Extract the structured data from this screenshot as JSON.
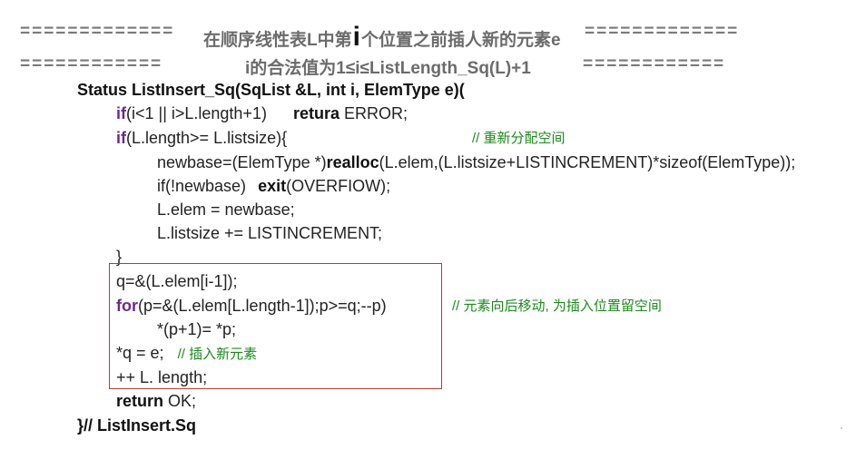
{
  "header": {
    "line1_left": "=============",
    "line1_text_a": "在顺序线性表L中第",
    "line1_big_i": "i",
    "line1_text_b": "个位置之前插人新的元素e",
    "line1_right": "=============",
    "line2_left": "============",
    "line2_text": "i的合法值为1≤i≤ListLength_Sq(L)+1",
    "line2_right": "============"
  },
  "code": {
    "l1": "Status ListInsert_Sq(SqList &L, int i, ElemType e)(",
    "l2_kw": "if",
    "l2_a": "(i<1 || i>L.length+1)",
    "l2_kw2": "retura",
    "l2_b": " ERROR;",
    "l3_kw": "if",
    "l3_a": "(L.length>= L.listsize){",
    "l3_cm": "// 重新分配空间",
    "l4_a": "newbase=(ElemType *)",
    "l4_kw": "realloc",
    "l4_b": "(L.elem,(L.listsize+LISTINCREMENT)*sizeof(ElemType));",
    "l5_a": "if(!newbase)",
    "l5_kw": "exit",
    "l5_b": "(OVERFIOW);",
    "l6": "L.elem = newbase;",
    "l7": "L.listsize += LISTINCREMENT;",
    "l8": "}",
    "l9": "q=&(L.elem[i-1]);",
    "l10_kw": "for",
    "l10_a": "(p=&(L.elem[L.length-1]);p>=q;--p)",
    "l10_cm": "// 元素向后移动, 为插入位置留空间",
    "l11": "*(p+1)= *p;",
    "l12_a": "*q = e;",
    "l12_cm": "// 插入新元素",
    "l13": "++ L. length;",
    "l14_kw": "return",
    "l14_a": " OK;",
    "l15": "}// ListInsert.Sq"
  }
}
